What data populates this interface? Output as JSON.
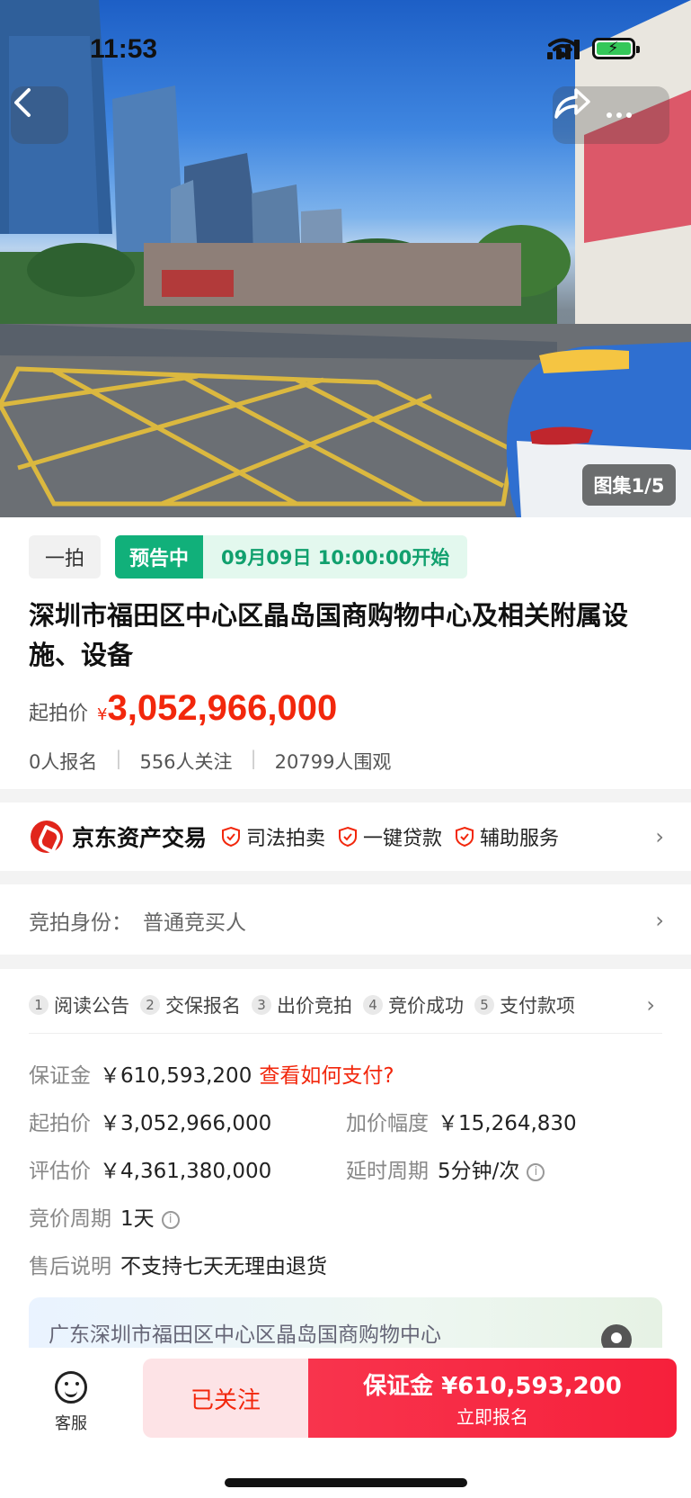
{
  "status_bar": {
    "time": "11:53"
  },
  "hero": {
    "gallery_label": "图集1/5"
  },
  "auction": {
    "round": "一拍",
    "status": "预告中",
    "start_time": "09月09日 10:00:00开始",
    "title": "深圳市福田区中心区晶岛国商购物中心及相关附属设施、设备",
    "starting_price_label": "起拍价",
    "currency_symbol": "¥",
    "starting_price": "3,052,966,000",
    "stats": [
      "0人报名",
      "556人关注",
      "20799人围观"
    ]
  },
  "brand": {
    "name": "京东资产交易",
    "features": [
      "司法拍卖",
      "一键贷款",
      "辅助服务"
    ]
  },
  "identity": {
    "label": "竞拍身份：",
    "value": "普通竞买人"
  },
  "steps": [
    {
      "num": "1",
      "label": "阅读公告"
    },
    {
      "num": "2",
      "label": "交保报名"
    },
    {
      "num": "3",
      "label": "出价竞拍"
    },
    {
      "num": "4",
      "label": "竞价成功"
    },
    {
      "num": "5",
      "label": "支付款项"
    }
  ],
  "details": {
    "deposit_label": "保证金",
    "deposit_value": "￥610,593,200",
    "deposit_link": "查看如何支付?",
    "start_label": "起拍价",
    "start_value": "￥3,052,966,000",
    "increment_label": "加价幅度",
    "increment_value": "￥15,264,830",
    "appraisal_label": "评估价",
    "appraisal_value": "￥4,361,380,000",
    "delay_label": "延时周期",
    "delay_value": "5分钟/次",
    "cycle_label": "竞价周期",
    "cycle_value": "1天",
    "aftersale_label": "售后说明",
    "aftersale_value": "不支持七天无理由退货"
  },
  "address": "广东深圳市福田区中心区晶岛国商购物中心",
  "bottom_bar": {
    "service_label": "客服",
    "follow_label": "已关注",
    "signup_main": "保证金 ¥610,593,200",
    "signup_sub": "立即报名"
  },
  "colors": {
    "accent_red": "#f2270c",
    "status_green": "#11b07a"
  }
}
